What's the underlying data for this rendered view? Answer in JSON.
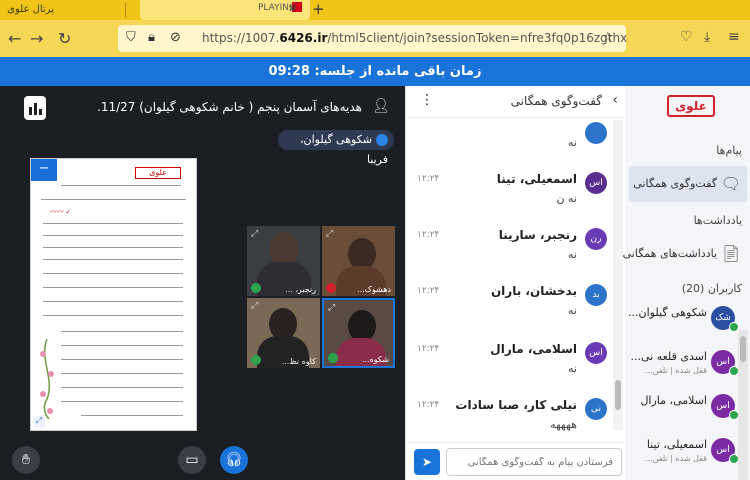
{
  "browser": {
    "tab_left_text": "پرتال علوی",
    "tab_title": "PLAYING",
    "url_prefix": "https://1007.",
    "url_domain": "6426.ir",
    "url_path": "/html5client/join?sessionToken=nfre3fq0p16zgthx"
  },
  "session": {
    "timer_text": "زمان باقی مانده از جلسه: 09:28"
  },
  "presentation": {
    "meeting_title": "هدیه‌های آسمان پنجم ( خانم شکوهی گیلوان) 11/27...",
    "presenter": "شکوهی گیلوان، فریبا",
    "videos": [
      {
        "name": "رنجبر، ..."
      },
      {
        "name": "دهشوک..."
      },
      {
        "name": "کاوه نظ..."
      },
      {
        "name": "شکوه..."
      }
    ]
  },
  "chat": {
    "title": "گفت‌وگوی همگانی",
    "input_placeholder": "فرستادن پیام به گفت‌وگوی همگانی",
    "messages": [
      {
        "avatar": "اس",
        "name": "اسمعیلی، تینا",
        "time": "۱۲:۲۴",
        "text": "نه ن",
        "color": "#5a2d91"
      },
      {
        "avatar": "رن",
        "name": "رنجبر، سارینا",
        "time": "۱۲:۲۴",
        "text": "نه",
        "color": "#6a3bb5"
      },
      {
        "avatar": "بد",
        "name": "بدخشان، باران",
        "time": "۱۲:۲۴",
        "text": "نه",
        "color": "#2b74c9"
      },
      {
        "avatar": "اس",
        "name": "اسلامی، مارال",
        "time": "۱۲:۲۴",
        "text": "نه",
        "color": "#6a3bb5"
      },
      {
        "avatar": "نی",
        "name": "نیلی کار، صبا سادات",
        "time": "۱۲:۲۴",
        "text": "ههههه",
        "color": "#2b74c9"
      }
    ],
    "partial_top_text": "نه"
  },
  "sidebar": {
    "logo": "علوی",
    "messages_label": "پیام‌ها",
    "public_chat_label": "گفت‌وگوی همگانی",
    "notes_label": "یادداشت‌ها",
    "shared_notes_label": "یادداشت‌های همگانی",
    "users_label": "کاربران (20)",
    "users": [
      {
        "avatar": "شک",
        "name": "شکوهی گیلوان...",
        "status": ""
      },
      {
        "avatar": "اس",
        "name": "اسدی قلعه نی...",
        "status": "قفل شده | تلفن..."
      },
      {
        "avatar": "اس",
        "name": "اسلامی، مارال",
        "status": ""
      },
      {
        "avatar": "اس",
        "name": "اسمعیلی، تینا",
        "status": "قفل شده | تلفن..."
      }
    ]
  }
}
